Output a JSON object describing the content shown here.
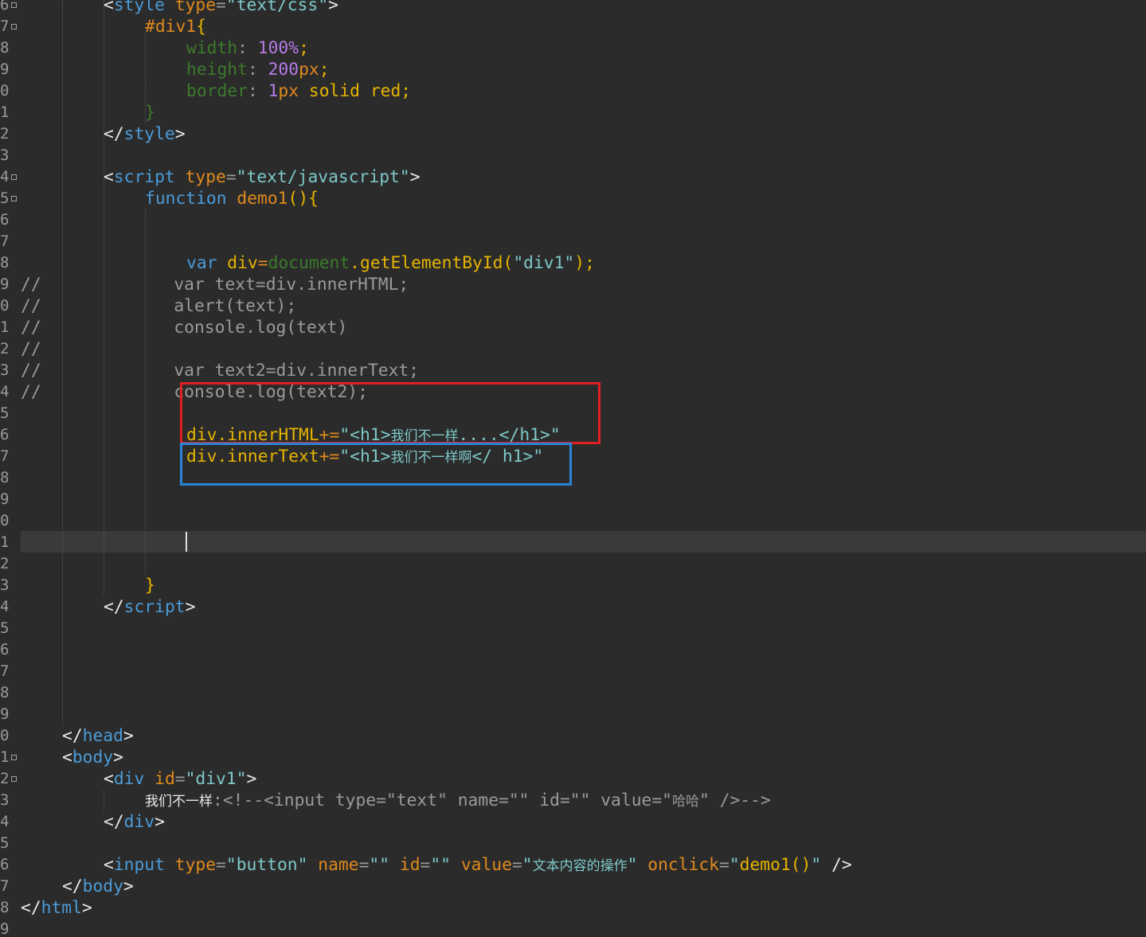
{
  "colors": {
    "background": "#2b2b2b",
    "current_line": "#3a3a3a",
    "line_number": "#9a9a9a",
    "tag_bracket": "#e8e8e8",
    "tag_name": "#4b9bd8",
    "attribute": "#e08a1e",
    "string": "#7ec8c8",
    "keyword": "#4b9bd8",
    "function_name": "#e6b400",
    "number": "#b57ce6",
    "property": "#3c7a2b",
    "global_object": "#3c7a2b",
    "comment": "#9a9a9a",
    "annotation_red": "#e02020",
    "annotation_blue": "#2a84d8"
  },
  "line_numbers": [
    {
      "text": "6",
      "fold": true
    },
    {
      "text": "7",
      "fold": true
    },
    {
      "text": "8",
      "fold": false
    },
    {
      "text": "9",
      "fold": false
    },
    {
      "text": "0",
      "fold": false
    },
    {
      "text": "1",
      "fold": false
    },
    {
      "text": "2",
      "fold": false
    },
    {
      "text": "3",
      "fold": false
    },
    {
      "text": "4",
      "fold": true
    },
    {
      "text": "5",
      "fold": true
    },
    {
      "text": "6",
      "fold": false
    },
    {
      "text": "7",
      "fold": false
    },
    {
      "text": "8",
      "fold": false
    },
    {
      "text": "9",
      "fold": false
    },
    {
      "text": "0",
      "fold": false
    },
    {
      "text": "1",
      "fold": false
    },
    {
      "text": "2",
      "fold": false
    },
    {
      "text": "3",
      "fold": false
    },
    {
      "text": "4",
      "fold": false
    },
    {
      "text": "5",
      "fold": false
    },
    {
      "text": "6",
      "fold": false
    },
    {
      "text": "7",
      "fold": false
    },
    {
      "text": "8",
      "fold": false
    },
    {
      "text": "9",
      "fold": false
    },
    {
      "text": "0",
      "fold": false
    },
    {
      "text": "1",
      "fold": false
    },
    {
      "text": "2",
      "fold": false
    },
    {
      "text": "3",
      "fold": false
    },
    {
      "text": "4",
      "fold": false
    },
    {
      "text": "5",
      "fold": false
    },
    {
      "text": "6",
      "fold": false
    },
    {
      "text": "7",
      "fold": false
    },
    {
      "text": "8",
      "fold": false
    },
    {
      "text": "9",
      "fold": false
    },
    {
      "text": "0",
      "fold": false
    },
    {
      "text": "1",
      "fold": true
    },
    {
      "text": "2",
      "fold": true
    },
    {
      "text": "3",
      "fold": false
    },
    {
      "text": "4",
      "fold": false
    },
    {
      "text": "5",
      "fold": false
    },
    {
      "text": "6",
      "fold": false
    },
    {
      "text": "7",
      "fold": false
    },
    {
      "text": "8",
      "fold": false
    },
    {
      "text": "9",
      "fold": false
    }
  ],
  "code_lines": [
    {
      "name": "style-open",
      "indent": 104,
      "tokens": [
        {
          "t": "<",
          "c": "tag_bracket"
        },
        {
          "t": "style",
          "c": "tag_name"
        },
        {
          "t": " type",
          "c": "attribute"
        },
        {
          "t": "=",
          "c": "comment"
        },
        {
          "t": "\"text/css\"",
          "c": "string"
        },
        {
          "t": ">",
          "c": "tag_bracket"
        }
      ]
    },
    {
      "name": "css-selector",
      "indent": 156,
      "tokens": [
        {
          "t": "#div1",
          "c": "attribute"
        },
        {
          "t": "{",
          "c": "function_name"
        }
      ]
    },
    {
      "name": "css-width",
      "indent": 208,
      "tokens": [
        {
          "t": "width",
          "c": "property"
        },
        {
          "t": ": ",
          "c": "comment"
        },
        {
          "t": "100%",
          "c": "number"
        },
        {
          "t": ";",
          "c": "function_name"
        }
      ]
    },
    {
      "name": "css-height",
      "indent": 208,
      "tokens": [
        {
          "t": "height",
          "c": "property"
        },
        {
          "t": ": ",
          "c": "comment"
        },
        {
          "t": "200",
          "c": "number"
        },
        {
          "t": "px",
          "c": "attribute"
        },
        {
          "t": ";",
          "c": "function_name"
        }
      ]
    },
    {
      "name": "css-border",
      "indent": 208,
      "tokens": [
        {
          "t": "border",
          "c": "property"
        },
        {
          "t": ": ",
          "c": "comment"
        },
        {
          "t": "1",
          "c": "number"
        },
        {
          "t": "px",
          "c": "attribute"
        },
        {
          "t": " solid red",
          "c": "function_name"
        },
        {
          "t": ";",
          "c": "function_name"
        }
      ]
    },
    {
      "name": "css-close",
      "indent": 156,
      "tokens": [
        {
          "t": "}",
          "c": "property"
        }
      ]
    },
    {
      "name": "style-close",
      "indent": 104,
      "tokens": [
        {
          "t": "</",
          "c": "tag_bracket"
        },
        {
          "t": "style",
          "c": "tag_name"
        },
        {
          "t": ">",
          "c": "tag_bracket"
        }
      ]
    },
    {
      "name": "blank",
      "indent": 0,
      "tokens": []
    },
    {
      "name": "script-open",
      "indent": 104,
      "tokens": [
        {
          "t": "<",
          "c": "tag_bracket"
        },
        {
          "t": "script",
          "c": "tag_name"
        },
        {
          "t": " type",
          "c": "attribute"
        },
        {
          "t": "=",
          "c": "comment"
        },
        {
          "t": "\"text/javascript\"",
          "c": "string"
        },
        {
          "t": ">",
          "c": "tag_bracket"
        }
      ]
    },
    {
      "name": "function-decl",
      "indent": 156,
      "tokens": [
        {
          "t": "function",
          "c": "keyword"
        },
        {
          "t": " demo1",
          "c": "attribute"
        },
        {
          "t": "(){",
          "c": "function_name"
        }
      ]
    },
    {
      "name": "blank",
      "indent": 0,
      "tokens": []
    },
    {
      "name": "blank",
      "indent": 0,
      "tokens": []
    },
    {
      "name": "var-div",
      "indent": 208,
      "tokens": [
        {
          "t": "var",
          "c": "keyword"
        },
        {
          "t": " div",
          "c": "function_name"
        },
        {
          "t": "=",
          "c": "attribute"
        },
        {
          "t": "document",
          "c": "global_object"
        },
        {
          "t": ".getElementById(",
          "c": "function_name"
        },
        {
          "t": "\"div1\"",
          "c": "string"
        },
        {
          "t": ");",
          "c": "function_name"
        }
      ]
    },
    {
      "name": "comment-var-text",
      "indent": 0,
      "tokens": [
        {
          "t": "//",
          "c": "comment"
        },
        {
          "t": "             var text=div.innerHTML;",
          "c": "comment"
        }
      ]
    },
    {
      "name": "comment-alert",
      "indent": 0,
      "tokens": [
        {
          "t": "//",
          "c": "comment"
        },
        {
          "t": "             alert(text);",
          "c": "comment"
        }
      ]
    },
    {
      "name": "comment-console-text",
      "indent": 0,
      "tokens": [
        {
          "t": "//",
          "c": "comment"
        },
        {
          "t": "             console.log(text)",
          "c": "comment"
        }
      ]
    },
    {
      "name": "comment-empty",
      "indent": 0,
      "tokens": [
        {
          "t": "//",
          "c": "comment"
        }
      ]
    },
    {
      "name": "comment-var-text2",
      "indent": 0,
      "tokens": [
        {
          "t": "//",
          "c": "comment"
        },
        {
          "t": "             var text2=div.innerText;",
          "c": "comment"
        }
      ]
    },
    {
      "name": "comment-console-text2",
      "indent": 0,
      "tokens": [
        {
          "t": "//",
          "c": "comment"
        },
        {
          "t": "             console.log(text2);",
          "c": "comment"
        }
      ]
    },
    {
      "name": "blank",
      "indent": 0,
      "tokens": []
    },
    {
      "name": "inner-html-line",
      "indent": 208,
      "tokens": [
        {
          "t": "div.innerHTML",
          "c": "function_name"
        },
        {
          "t": "+=",
          "c": "attribute"
        },
        {
          "t": "\"<h1>",
          "c": "string"
        },
        {
          "t": "我们不一样",
          "c": "string",
          "cjk": true
        },
        {
          "t": "....</h1>\"",
          "c": "string"
        }
      ]
    },
    {
      "name": "inner-text-line",
      "indent": 208,
      "tokens": [
        {
          "t": "div.innerText",
          "c": "function_name"
        },
        {
          "t": "+=",
          "c": "attribute"
        },
        {
          "t": "\"<h1>",
          "c": "string"
        },
        {
          "t": "我们不一样啊",
          "c": "string",
          "cjk": true
        },
        {
          "t": "</ h1>\"",
          "c": "string"
        }
      ]
    },
    {
      "name": "blank",
      "indent": 0,
      "tokens": []
    },
    {
      "name": "blank",
      "indent": 0,
      "tokens": []
    },
    {
      "name": "blank",
      "indent": 0,
      "tokens": []
    },
    {
      "name": "blank",
      "indent": 0,
      "tokens": []
    },
    {
      "name": "blank",
      "indent": 0,
      "tokens": []
    },
    {
      "name": "function-close",
      "indent": 156,
      "tokens": [
        {
          "t": "}",
          "c": "function_name"
        }
      ]
    },
    {
      "name": "script-close",
      "indent": 104,
      "tokens": [
        {
          "t": "</",
          "c": "tag_bracket"
        },
        {
          "t": "script",
          "c": "tag_name"
        },
        {
          "t": ">",
          "c": "tag_bracket"
        }
      ]
    },
    {
      "name": "blank",
      "indent": 0,
      "tokens": []
    },
    {
      "name": "blank",
      "indent": 0,
      "tokens": []
    },
    {
      "name": "blank",
      "indent": 0,
      "tokens": []
    },
    {
      "name": "blank",
      "indent": 0,
      "tokens": []
    },
    {
      "name": "blank",
      "indent": 0,
      "tokens": []
    },
    {
      "name": "head-close",
      "indent": 52,
      "tokens": [
        {
          "t": "</",
          "c": "tag_bracket"
        },
        {
          "t": "head",
          "c": "tag_name"
        },
        {
          "t": ">",
          "c": "tag_bracket"
        }
      ]
    },
    {
      "name": "body-open",
      "indent": 52,
      "tokens": [
        {
          "t": "<",
          "c": "tag_bracket"
        },
        {
          "t": "body",
          "c": "tag_name"
        },
        {
          "t": ">",
          "c": "tag_bracket"
        }
      ]
    },
    {
      "name": "div-open",
      "indent": 104,
      "tokens": [
        {
          "t": "<",
          "c": "tag_bracket"
        },
        {
          "t": "div",
          "c": "tag_name"
        },
        {
          "t": " id",
          "c": "attribute"
        },
        {
          "t": "=",
          "c": "comment"
        },
        {
          "t": "\"div1\"",
          "c": "string"
        },
        {
          "t": ">",
          "c": "tag_bracket"
        }
      ]
    },
    {
      "name": "div-content",
      "indent": 156,
      "tokens": [
        {
          "t": "我们不一样",
          "c": "tag_bracket",
          "cjk": true
        },
        {
          "t": ":<!--<input type=\"text\" name=\"\" id=\"\" value=\"",
          "c": "comment"
        },
        {
          "t": "哈哈",
          "c": "comment",
          "cjk": true
        },
        {
          "t": "\" />-->",
          "c": "comment"
        }
      ]
    },
    {
      "name": "div-close",
      "indent": 104,
      "tokens": [
        {
          "t": "</",
          "c": "tag_bracket"
        },
        {
          "t": "div",
          "c": "tag_name"
        },
        {
          "t": ">",
          "c": "tag_bracket"
        }
      ]
    },
    {
      "name": "blank",
      "indent": 0,
      "tokens": []
    },
    {
      "name": "input-button",
      "indent": 104,
      "tokens": [
        {
          "t": "<",
          "c": "tag_bracket"
        },
        {
          "t": "input",
          "c": "tag_name"
        },
        {
          "t": " type",
          "c": "attribute"
        },
        {
          "t": "=",
          "c": "comment"
        },
        {
          "t": "\"button\"",
          "c": "string"
        },
        {
          "t": " name",
          "c": "attribute"
        },
        {
          "t": "=",
          "c": "comment"
        },
        {
          "t": "\"\"",
          "c": "string"
        },
        {
          "t": " id",
          "c": "attribute"
        },
        {
          "t": "=",
          "c": "comment"
        },
        {
          "t": "\"\"",
          "c": "string"
        },
        {
          "t": " value",
          "c": "attribute"
        },
        {
          "t": "=",
          "c": "comment"
        },
        {
          "t": "\"",
          "c": "string"
        },
        {
          "t": "文本内容的操作",
          "c": "string",
          "cjk": true
        },
        {
          "t": "\"",
          "c": "string"
        },
        {
          "t": " onclick",
          "c": "attribute"
        },
        {
          "t": "=",
          "c": "comment"
        },
        {
          "t": "\"",
          "c": "string"
        },
        {
          "t": "demo1()",
          "c": "function_name"
        },
        {
          "t": "\"",
          "c": "string"
        },
        {
          "t": " />",
          "c": "tag_bracket"
        }
      ]
    },
    {
      "name": "body-close",
      "indent": 52,
      "tokens": [
        {
          "t": "</",
          "c": "tag_bracket"
        },
        {
          "t": "body",
          "c": "tag_name"
        },
        {
          "t": ">",
          "c": "tag_bracket"
        }
      ]
    },
    {
      "name": "html-close",
      "indent": 0,
      "tokens": [
        {
          "t": "</",
          "c": "tag_bracket"
        },
        {
          "t": "html",
          "c": "tag_name"
        },
        {
          "t": ">",
          "c": "tag_bracket"
        }
      ]
    },
    {
      "name": "blank",
      "indent": 0,
      "tokens": []
    }
  ]
}
